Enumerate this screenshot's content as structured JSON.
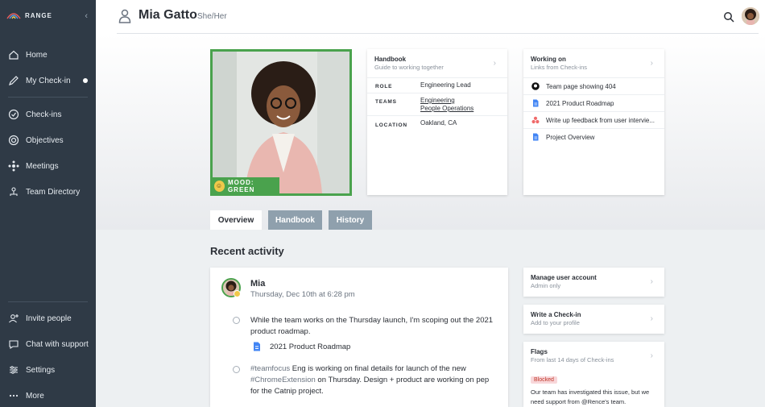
{
  "brand": {
    "name": "RANGE"
  },
  "sidebar": {
    "items": [
      {
        "label": "Home",
        "icon": "home-icon"
      },
      {
        "label": "My Check-in",
        "icon": "pencil-icon"
      },
      {
        "label": "Check-ins",
        "icon": "check-circle-icon"
      },
      {
        "label": "Objectives",
        "icon": "target-icon"
      },
      {
        "label": "Meetings",
        "icon": "meetings-icon"
      },
      {
        "label": "Team Directory",
        "icon": "directory-icon"
      }
    ],
    "bottom_items": [
      {
        "label": "Invite people",
        "icon": "add-person-icon"
      },
      {
        "label": "Chat with support",
        "icon": "chat-icon"
      },
      {
        "label": "Settings",
        "icon": "sliders-icon"
      },
      {
        "label": "More",
        "icon": "more-icon"
      }
    ]
  },
  "header": {
    "name": "Mia Gatto",
    "pronouns": "She/Her"
  },
  "profile": {
    "mood": "MOOD: GREEN"
  },
  "handbook_card": {
    "title": "Handbook",
    "subtitle": "Guide to working together",
    "role_label": "ROLE",
    "role_value": "Engineering Lead",
    "teams_label": "TEAMS",
    "teams": [
      "Engineering",
      "People Operations"
    ],
    "location_label": "LOCATION",
    "location_value": "Oakland, CA"
  },
  "working_card": {
    "title": "Working on",
    "subtitle": "Links from Check-ins",
    "links": [
      {
        "label": "Team page showing 404",
        "icon": "github-icon"
      },
      {
        "label": "2021 Product Roadmap",
        "icon": "doc-icon"
      },
      {
        "label": "Write up feedback from user intervie...",
        "icon": "asana-icon"
      },
      {
        "label": "Project Overview",
        "icon": "doc-icon"
      }
    ]
  },
  "tabs": [
    {
      "label": "Overview",
      "active": true
    },
    {
      "label": "Handbook",
      "active": false
    },
    {
      "label": "History",
      "active": false
    }
  ],
  "recent": {
    "title": "Recent activity",
    "author": "Mia",
    "date": "Thursday, Dec 10th at 6:28 pm",
    "item1": "While the team works on the Thursday launch, I'm scoping out the 2021 product roadmap.",
    "item1_link": "2021 Product Roadmap",
    "item2_tag": "#teamfocus",
    "item2_a": " Eng is working on final details for launch of the new ",
    "item2_tag2": "#ChromeExtension",
    "item2_b": " on Thursday. Design + product are working on pep for the Catnip project."
  },
  "side_cards": {
    "manage": {
      "title": "Manage user account",
      "subtitle": "Admin only"
    },
    "write": {
      "title": "Write a Check-in",
      "subtitle": "Add to your profile"
    },
    "flags": {
      "title": "Flags",
      "subtitle": "From last 14 days of Check-ins",
      "badge": "Blocked",
      "text": "Our team has investigated this issue, but we need support from @Rence's team."
    }
  },
  "colors": {
    "sidebar": "#2f3a46",
    "mood_green": "#4aa24d",
    "tab_inactive": "#8fa0ad"
  }
}
